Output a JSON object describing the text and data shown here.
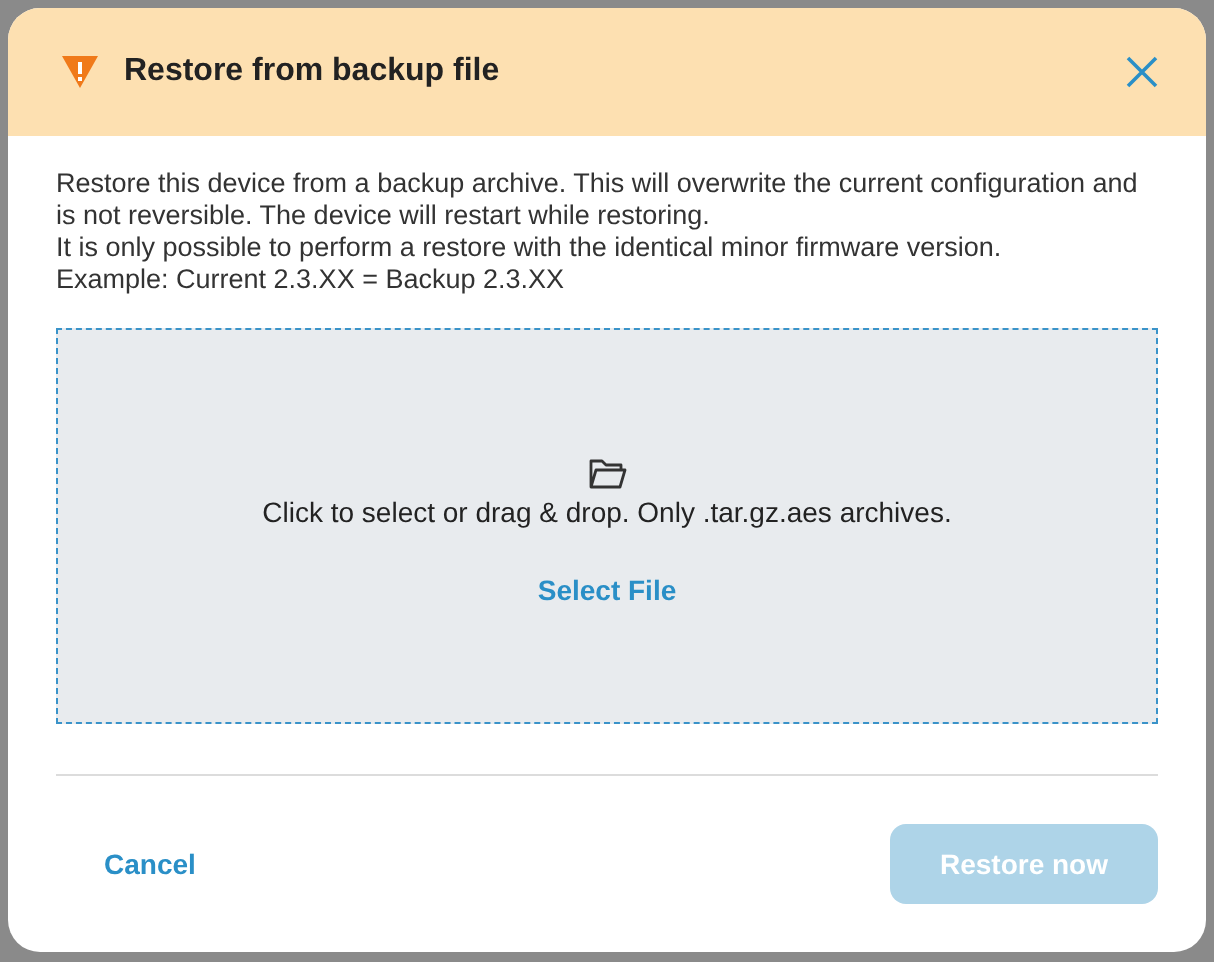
{
  "dialog": {
    "title": "Restore from backup file",
    "description": [
      "Restore this device from a backup archive. This will overwrite the current configuration and is not reversible. The device will restart while restoring.",
      "It is only possible to perform a restore with the identical minor firmware version.",
      "Example: Current 2.3.XX = Backup 2.3.XX"
    ],
    "dropzone": {
      "hint": "Click to select or drag & drop. Only .tar.gz.aes archives.",
      "link": "Select File"
    },
    "buttons": [
      {
        "label": "Cancel",
        "kind": "text",
        "disabled": false
      },
      {
        "label": "Restore now",
        "kind": "primary",
        "disabled": true
      }
    ]
  }
}
